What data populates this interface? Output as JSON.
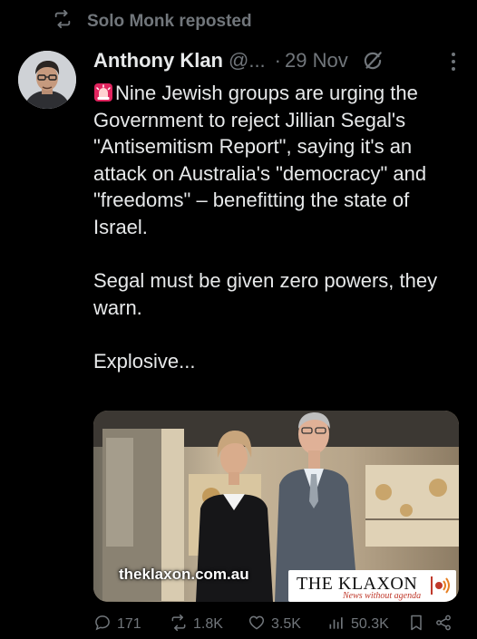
{
  "repost": {
    "label": "Solo Monk reposted",
    "icon": "repost-icon"
  },
  "author": {
    "name": "Anthony Klan",
    "handle": "@...",
    "separator": "·",
    "date": "29 Nov"
  },
  "tweet": {
    "text": "Nine Jewish groups are urging the Government to reject Jillian Segal's \"Antisemitism Report\", saying it's an attack on Australia's \"democracy\" and \"freedoms\" – benefitting the state of Israel.\n\nSegal must be given zero powers, they warn.\n\nExplosive..."
  },
  "media": {
    "watermark": "theklaxon.com.au",
    "brand_title": "THE KLAXON",
    "brand_tagline": "News without agenda"
  },
  "actions": {
    "replies": "171",
    "reposts": "1.8K",
    "likes": "3.5K",
    "views": "50.3K"
  },
  "colors": {
    "background": "#000000",
    "text": "#e7e9ea",
    "muted": "#71767b",
    "brand_red": "#c0392b"
  }
}
